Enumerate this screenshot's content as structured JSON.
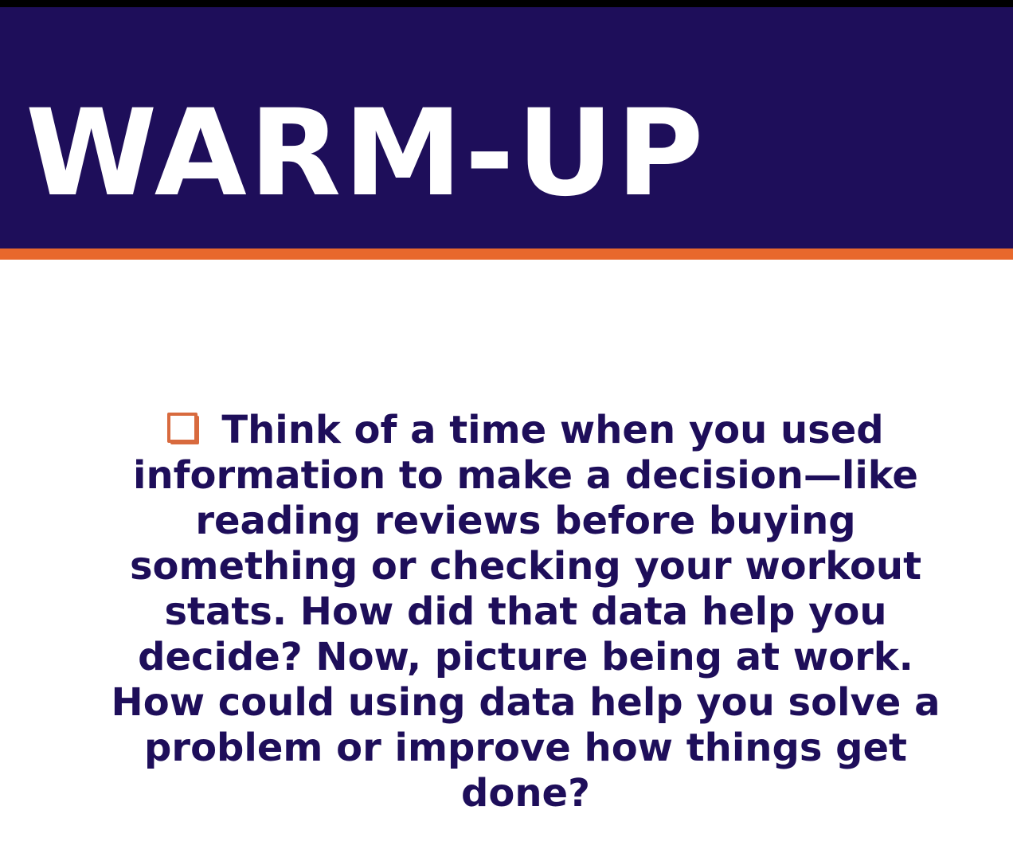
{
  "slide": {
    "title": "WARM-UP",
    "bullet_icon": "checkbox-icon",
    "body": "Think of a time when you used information to make a decision—like reading reviews before buying something or checking your workout stats. How did that data help you decide? Now, picture being at work. How could using data help you solve a problem or improve how things get done?"
  },
  "colors": {
    "title_band": "#1e0e5a",
    "accent_rule": "#e8682c",
    "body_text": "#1e0e5a",
    "bullet_icon": "#d86a3e",
    "title_text": "#ffffff"
  }
}
